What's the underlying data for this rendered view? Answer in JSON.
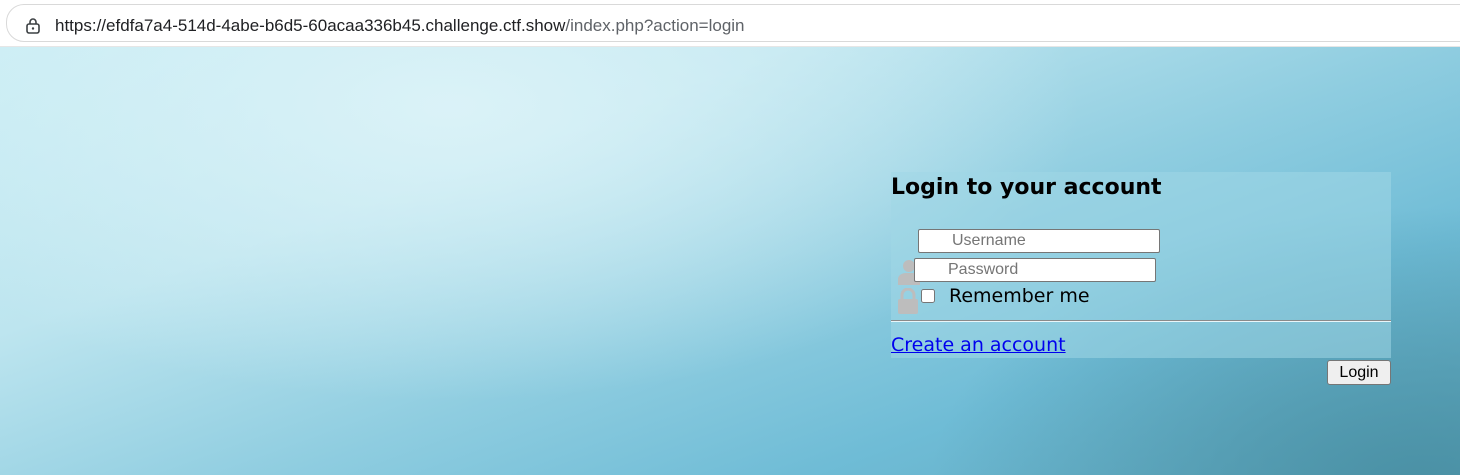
{
  "browser": {
    "url_main": "https://efdfa7a4-514d-4abe-b6d5-60acaa336b45.challenge.ctf.show",
    "url_path": "/index.php?action=login",
    "site_icon": "site-info-icon"
  },
  "login": {
    "title": "Login to your account",
    "username_placeholder": "Username",
    "username_value": "",
    "password_placeholder": "Password",
    "password_value": "",
    "remember_label": "Remember me",
    "remember_checked": false,
    "create_account_link": "Create an account",
    "login_button": "Login",
    "user_icon": "user-icon",
    "lock_icon": "lock-icon"
  },
  "colors": {
    "link": "#0000ee",
    "icon_gray": "#bdbdbd"
  }
}
